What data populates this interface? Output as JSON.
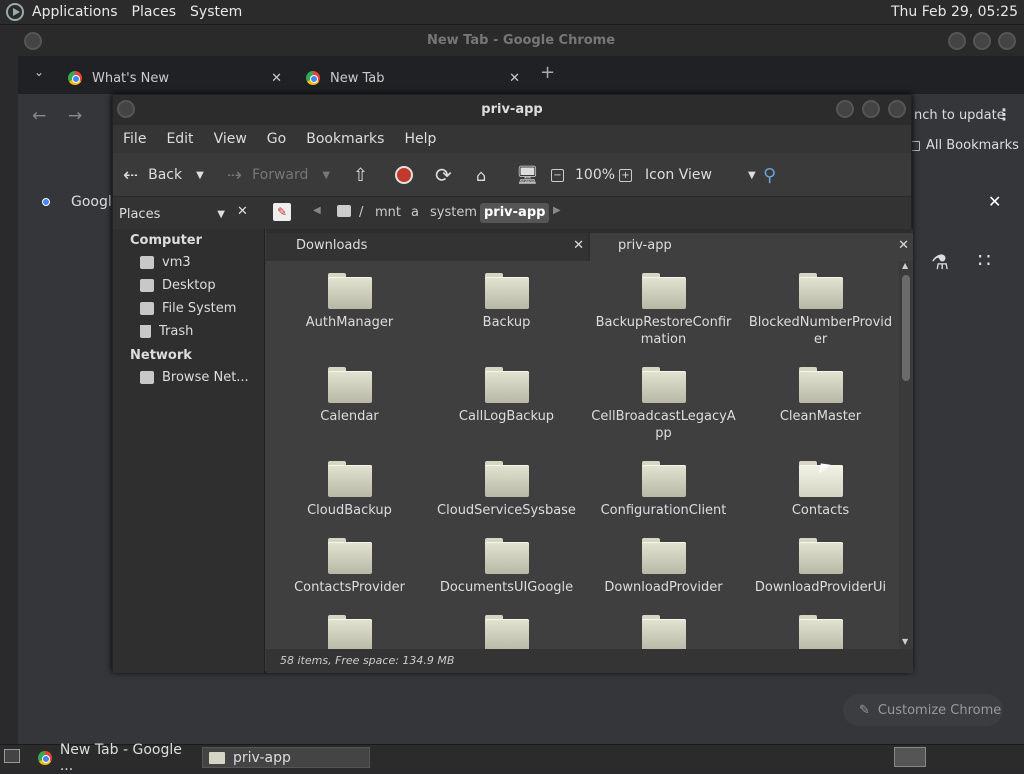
{
  "panel": {
    "menu_applications": "Applications",
    "menu_places": "Places",
    "menu_system": "System",
    "clock": "Thu Feb 29, 05:25"
  },
  "chrome": {
    "title": "New Tab - Google Chrome",
    "tabs": [
      {
        "label": "What's New"
      },
      {
        "label": "New Tab"
      }
    ],
    "relaunch_label": "nch to update",
    "all_bookmarks": "All Bookmarks",
    "google_label": "Googl",
    "customize_label": "Customize Chrome"
  },
  "fm": {
    "title": "priv-app",
    "menu": [
      "File",
      "Edit",
      "View",
      "Go",
      "Bookmarks",
      "Help"
    ],
    "toolbar": {
      "back": "Back",
      "forward": "Forward",
      "zoom": "100%",
      "view_mode": "Icon View"
    },
    "location": {
      "crumbs": [
        "/",
        "mnt",
        "a",
        "system",
        "priv-app"
      ]
    },
    "sidebar": {
      "selector": "Places",
      "computer_header": "Computer",
      "computer_items": [
        "vm3",
        "Desktop",
        "File System",
        "Trash"
      ],
      "network_header": "Network",
      "network_items": [
        "Browse Net..."
      ]
    },
    "tabs": [
      {
        "label": "Downloads"
      },
      {
        "label": "priv-app"
      }
    ],
    "items": [
      {
        "l1": "AuthManager",
        "l2": ""
      },
      {
        "l1": "Backup",
        "l2": ""
      },
      {
        "l1": "BackupRestoreConfir",
        "l2": "mation"
      },
      {
        "l1": "BlockedNumberProvid",
        "l2": "er"
      },
      {
        "l1": "Calendar",
        "l2": ""
      },
      {
        "l1": "CallLogBackup",
        "l2": ""
      },
      {
        "l1": "CellBroadcastLegacyA",
        "l2": "pp"
      },
      {
        "l1": "CleanMaster",
        "l2": ""
      },
      {
        "l1": "CloudBackup",
        "l2": ""
      },
      {
        "l1": "CloudServiceSysbase",
        "l2": ""
      },
      {
        "l1": "ConfigurationClient",
        "l2": ""
      },
      {
        "l1": "Contacts",
        "l2": ""
      },
      {
        "l1": "ContactsProvider",
        "l2": ""
      },
      {
        "l1": "DocumentsUIGoogle",
        "l2": ""
      },
      {
        "l1": "DownloadProvider",
        "l2": ""
      },
      {
        "l1": "DownloadProviderUi",
        "l2": ""
      }
    ],
    "status": "58 items, Free space: 134.9 MB"
  },
  "taskbar": {
    "chrome_task": "New Tab - Google ...",
    "fm_task": "priv-app"
  }
}
